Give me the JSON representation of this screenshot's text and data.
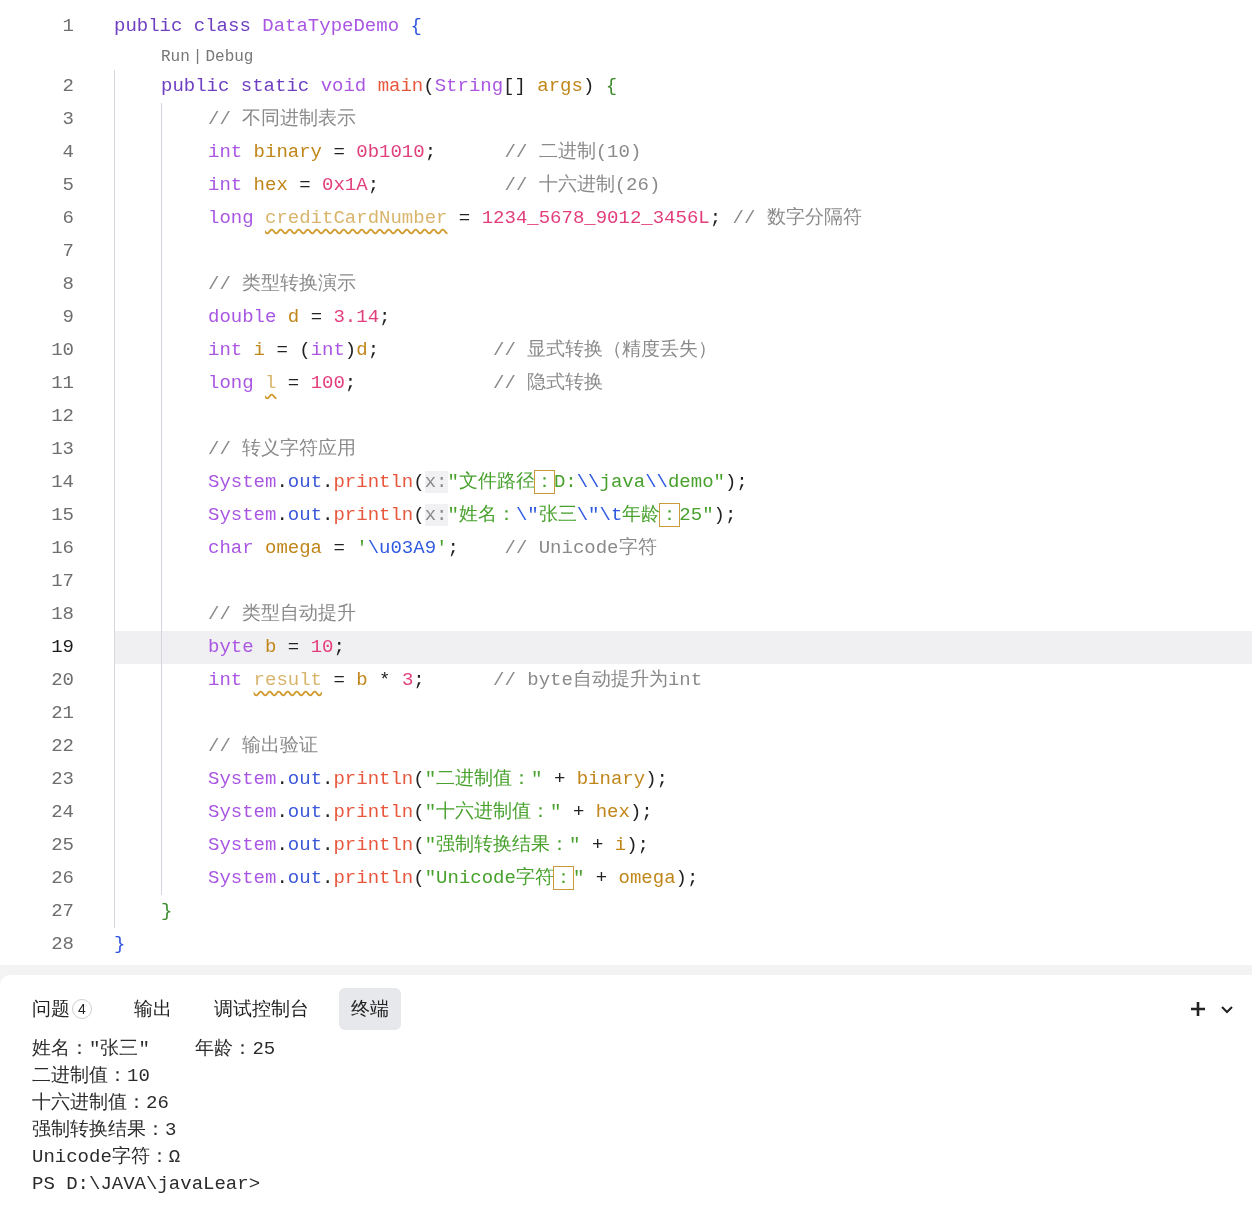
{
  "editor": {
    "lines": [
      {
        "kind": "code",
        "number": "1",
        "current": false,
        "tokens": [
          {
            "text": "public class ",
            "kind": "modifier"
          },
          {
            "text": "DataTypeDemo ",
            "kind": "type"
          },
          {
            "text": "{",
            "kind": "bracket-a"
          }
        ],
        "children": [
          {
            "kind": "codelens",
            "links": [
              "Run",
              "Debug"
            ],
            "separator": "|"
          },
          {
            "kind": "code",
            "number": "2",
            "current": false,
            "tokens": [
              {
                "text": "public static ",
                "kind": "modifier"
              },
              {
                "text": "void ",
                "kind": "type"
              },
              {
                "text": "main",
                "kind": "method"
              },
              {
                "text": "(",
                "kind": "punct"
              },
              {
                "text": "String",
                "kind": "type"
              },
              {
                "text": "[] ",
                "kind": "punct"
              },
              {
                "text": "args",
                "kind": "ident"
              },
              {
                "text": ") ",
                "kind": "punct"
              },
              {
                "text": "{",
                "kind": "bracket-b"
              }
            ],
            "children": [
              {
                "kind": "code",
                "number": "3",
                "current": false,
                "tokens": [
                  {
                    "text": "// 不同进制表示",
                    "kind": "comment"
                  }
                ]
              },
              {
                "kind": "code",
                "number": "4",
                "current": false,
                "tokens": [
                  {
                    "text": "int ",
                    "kind": "type"
                  },
                  {
                    "text": "binary",
                    "kind": "ident"
                  },
                  {
                    "text": " = ",
                    "kind": "punct"
                  },
                  {
                    "text": "0b1010",
                    "kind": "number"
                  },
                  {
                    "text": ";      ",
                    "kind": "punct"
                  },
                  {
                    "text": "// 二进制(10)",
                    "kind": "comment"
                  }
                ]
              },
              {
                "kind": "code",
                "number": "5",
                "current": false,
                "tokens": [
                  {
                    "text": "int ",
                    "kind": "type"
                  },
                  {
                    "text": "hex",
                    "kind": "ident"
                  },
                  {
                    "text": " = ",
                    "kind": "punct"
                  },
                  {
                    "text": "0x1A",
                    "kind": "number"
                  },
                  {
                    "text": ";           ",
                    "kind": "punct"
                  },
                  {
                    "text": "// 十六进制(26)",
                    "kind": "comment"
                  }
                ]
              },
              {
                "kind": "code",
                "number": "6",
                "current": false,
                "tokens": [
                  {
                    "text": "long ",
                    "kind": "type"
                  },
                  {
                    "text": "creditCardNumber",
                    "kind": "warn"
                  },
                  {
                    "text": " = ",
                    "kind": "punct"
                  },
                  {
                    "text": "1234_5678_9012_3456L",
                    "kind": "number"
                  },
                  {
                    "text": "; ",
                    "kind": "punct"
                  },
                  {
                    "text": "// 数字分隔符",
                    "kind": "comment"
                  }
                ]
              },
              {
                "kind": "code",
                "number": "7",
                "current": false
              },
              {
                "kind": "code",
                "number": "8",
                "current": false,
                "tokens": [
                  {
                    "text": "// 类型转换演示",
                    "kind": "comment"
                  }
                ]
              },
              {
                "kind": "code",
                "number": "9",
                "current": false,
                "tokens": [
                  {
                    "text": "double ",
                    "kind": "type"
                  },
                  {
                    "text": "d",
                    "kind": "ident"
                  },
                  {
                    "text": " = ",
                    "kind": "punct"
                  },
                  {
                    "text": "3.14",
                    "kind": "number"
                  },
                  {
                    "text": ";",
                    "kind": "punct"
                  }
                ]
              },
              {
                "kind": "code",
                "number": "10",
                "current": false,
                "tokens": [
                  {
                    "text": "int ",
                    "kind": "type"
                  },
                  {
                    "text": "i",
                    "kind": "ident"
                  },
                  {
                    "text": " = (",
                    "kind": "punct"
                  },
                  {
                    "text": "int",
                    "kind": "type"
                  },
                  {
                    "text": ")",
                    "kind": "punct"
                  },
                  {
                    "text": "d",
                    "kind": "ident"
                  },
                  {
                    "text": ";          ",
                    "kind": "punct"
                  },
                  {
                    "text": "// 显式转换（精度丢失）",
                    "kind": "comment"
                  }
                ]
              },
              {
                "kind": "code",
                "number": "11",
                "current": false,
                "tokens": [
                  {
                    "text": "long ",
                    "kind": "type"
                  },
                  {
                    "text": "l",
                    "kind": "warn"
                  },
                  {
                    "text": " = ",
                    "kind": "punct"
                  },
                  {
                    "text": "100",
                    "kind": "number"
                  },
                  {
                    "text": ";            ",
                    "kind": "punct"
                  },
                  {
                    "text": "// 隐式转换",
                    "kind": "comment"
                  }
                ]
              },
              {
                "kind": "code",
                "number": "12",
                "current": false
              },
              {
                "kind": "code",
                "number": "13",
                "current": false,
                "tokens": [
                  {
                    "text": "// 转义字符应用",
                    "kind": "comment"
                  }
                ]
              },
              {
                "kind": "code",
                "number": "14",
                "current": false,
                "tokens": [
                  {
                    "text": "System",
                    "kind": "type"
                  },
                  {
                    "text": ".",
                    "kind": "punct"
                  },
                  {
                    "text": "out",
                    "kind": "field"
                  },
                  {
                    "text": ".",
                    "kind": "punct"
                  },
                  {
                    "text": "println",
                    "kind": "method"
                  },
                  {
                    "text": "(",
                    "kind": "punct"
                  },
                  {
                    "text": "x:",
                    "kind": "hint"
                  },
                  {
                    "text": "\"文件路径",
                    "kind": "string"
                  },
                  {
                    "text": "：",
                    "kind": "boxed"
                  },
                  {
                    "text": "D:",
                    "kind": "string"
                  },
                  {
                    "text": "\\\\",
                    "kind": "escape"
                  },
                  {
                    "text": "java",
                    "kind": "string"
                  },
                  {
                    "text": "\\\\",
                    "kind": "escape"
                  },
                  {
                    "text": "demo\"",
                    "kind": "string"
                  },
                  {
                    "text": ");",
                    "kind": "punct"
                  }
                ]
              },
              {
                "kind": "code",
                "number": "15",
                "current": false,
                "tokens": [
                  {
                    "text": "System",
                    "kind": "type"
                  },
                  {
                    "text": ".",
                    "kind": "punct"
                  },
                  {
                    "text": "out",
                    "kind": "field"
                  },
                  {
                    "text": ".",
                    "kind": "punct"
                  },
                  {
                    "text": "println",
                    "kind": "method"
                  },
                  {
                    "text": "(",
                    "kind": "punct"
                  },
                  {
                    "text": "x:",
                    "kind": "hint"
                  },
                  {
                    "text": "\"姓名：",
                    "kind": "string"
                  },
                  {
                    "text": "\\\"",
                    "kind": "escape"
                  },
                  {
                    "text": "张三",
                    "kind": "string"
                  },
                  {
                    "text": "\\\"",
                    "kind": "escape"
                  },
                  {
                    "text": "\\t",
                    "kind": "escape"
                  },
                  {
                    "text": "年龄",
                    "kind": "string"
                  },
                  {
                    "text": "：",
                    "kind": "boxed"
                  },
                  {
                    "text": "25\"",
                    "kind": "string"
                  },
                  {
                    "text": ");",
                    "kind": "punct"
                  }
                ]
              },
              {
                "kind": "code",
                "number": "16",
                "current": false,
                "tokens": [
                  {
                    "text": "char ",
                    "kind": "type"
                  },
                  {
                    "text": "omega",
                    "kind": "ident"
                  },
                  {
                    "text": " = ",
                    "kind": "punct"
                  },
                  {
                    "text": "'",
                    "kind": "string"
                  },
                  {
                    "text": "\\u03A9",
                    "kind": "escape"
                  },
                  {
                    "text": "'",
                    "kind": "string"
                  },
                  {
                    "text": ";    ",
                    "kind": "punct"
                  },
                  {
                    "text": "// Unicode字符",
                    "kind": "comment"
                  }
                ]
              },
              {
                "kind": "code",
                "number": "17",
                "current": false
              },
              {
                "kind": "code",
                "number": "18",
                "current": false,
                "tokens": [
                  {
                    "text": "// 类型自动提升",
                    "kind": "comment"
                  }
                ]
              },
              {
                "kind": "code",
                "number": "19",
                "current": true,
                "tokens": [
                  {
                    "text": "byte ",
                    "kind": "type"
                  },
                  {
                    "text": "b",
                    "kind": "ident"
                  },
                  {
                    "text": " = ",
                    "kind": "punct"
                  },
                  {
                    "text": "10",
                    "kind": "number"
                  },
                  {
                    "text": ";",
                    "kind": "punct"
                  }
                ]
              },
              {
                "kind": "code",
                "number": "20",
                "current": false,
                "tokens": [
                  {
                    "text": "int ",
                    "kind": "type"
                  },
                  {
                    "text": "result",
                    "kind": "warn"
                  },
                  {
                    "text": " = ",
                    "kind": "punct"
                  },
                  {
                    "text": "b",
                    "kind": "ident"
                  },
                  {
                    "text": " * ",
                    "kind": "punct"
                  },
                  {
                    "text": "3",
                    "kind": "number"
                  },
                  {
                    "text": ";      ",
                    "kind": "punct"
                  },
                  {
                    "text": "// byte自动提升为int",
                    "kind": "comment"
                  }
                ]
              },
              {
                "kind": "code",
                "number": "21",
                "current": false
              },
              {
                "kind": "code",
                "number": "22",
                "current": false,
                "tokens": [
                  {
                    "text": "// 输出验证",
                    "kind": "comment"
                  }
                ]
              },
              {
                "kind": "code",
                "number": "23",
                "current": false,
                "tokens": [
                  {
                    "text": "System",
                    "kind": "type"
                  },
                  {
                    "text": ".",
                    "kind": "punct"
                  },
                  {
                    "text": "out",
                    "kind": "field"
                  },
                  {
                    "text": ".",
                    "kind": "punct"
                  },
                  {
                    "text": "println",
                    "kind": "method"
                  },
                  {
                    "text": "(",
                    "kind": "punct"
                  },
                  {
                    "text": "\"二进制值：\"",
                    "kind": "string"
                  },
                  {
                    "text": " + ",
                    "kind": "punct"
                  },
                  {
                    "text": "binary",
                    "kind": "ident"
                  },
                  {
                    "text": ");",
                    "kind": "punct"
                  }
                ]
              },
              {
                "kind": "code",
                "number": "24",
                "current": false,
                "tokens": [
                  {
                    "text": "System",
                    "kind": "type"
                  },
                  {
                    "text": ".",
                    "kind": "punct"
                  },
                  {
                    "text": "out",
                    "kind": "field"
                  },
                  {
                    "text": ".",
                    "kind": "punct"
                  },
                  {
                    "text": "println",
                    "kind": "method"
                  },
                  {
                    "text": "(",
                    "kind": "punct"
                  },
                  {
                    "text": "\"十六进制值：\"",
                    "kind": "string"
                  },
                  {
                    "text": " + ",
                    "kind": "punct"
                  },
                  {
                    "text": "hex",
                    "kind": "ident"
                  },
                  {
                    "text": ");",
                    "kind": "punct"
                  }
                ]
              },
              {
                "kind": "code",
                "number": "25",
                "current": false,
                "tokens": [
                  {
                    "text": "System",
                    "kind": "type"
                  },
                  {
                    "text": ".",
                    "kind": "punct"
                  },
                  {
                    "text": "out",
                    "kind": "field"
                  },
                  {
                    "text": ".",
                    "kind": "punct"
                  },
                  {
                    "text": "println",
                    "kind": "method"
                  },
                  {
                    "text": "(",
                    "kind": "punct"
                  },
                  {
                    "text": "\"强制转换结果：\"",
                    "kind": "string"
                  },
                  {
                    "text": " + ",
                    "kind": "punct"
                  },
                  {
                    "text": "i",
                    "kind": "ident"
                  },
                  {
                    "text": ");",
                    "kind": "punct"
                  }
                ]
              },
              {
                "kind": "code",
                "number": "26",
                "current": false,
                "tokens": [
                  {
                    "text": "System",
                    "kind": "type"
                  },
                  {
                    "text": ".",
                    "kind": "punct"
                  },
                  {
                    "text": "out",
                    "kind": "field"
                  },
                  {
                    "text": ".",
                    "kind": "punct"
                  },
                  {
                    "text": "println",
                    "kind": "method"
                  },
                  {
                    "text": "(",
                    "kind": "punct"
                  },
                  {
                    "text": "\"Unicode字符",
                    "kind": "string"
                  },
                  {
                    "text": "：",
                    "kind": "boxed"
                  },
                  {
                    "text": "\"",
                    "kind": "string"
                  },
                  {
                    "text": " + ",
                    "kind": "punct"
                  },
                  {
                    "text": "omega",
                    "kind": "ident"
                  },
                  {
                    "text": ");",
                    "kind": "punct"
                  }
                ]
              }
            ]
          },
          {
            "kind": "code",
            "number": "27",
            "current": false,
            "tokens": [
              {
                "text": "}",
                "kind": "bracket-b"
              }
            ]
          }
        ]
      },
      {
        "kind": "code",
        "number": "28",
        "current": false,
        "tokens": [
          {
            "text": "}",
            "kind": "bracket-a"
          }
        ]
      }
    ]
  },
  "panel": {
    "tabs": [
      {
        "label": "问题",
        "badge": "4",
        "selected": false
      },
      {
        "label": "输出",
        "selected": false
      },
      {
        "label": "调试控制台",
        "selected": false
      },
      {
        "label": "终端",
        "selected": true
      }
    ],
    "terminal": {
      "lines": [
        "姓名：\"张三\"    年龄：25",
        "二进制值：10",
        "十六进制值：26",
        "强制转换结果：3",
        "Unicode字符：Ω",
        "PS D:\\JAVA\\javaLear>"
      ]
    }
  }
}
